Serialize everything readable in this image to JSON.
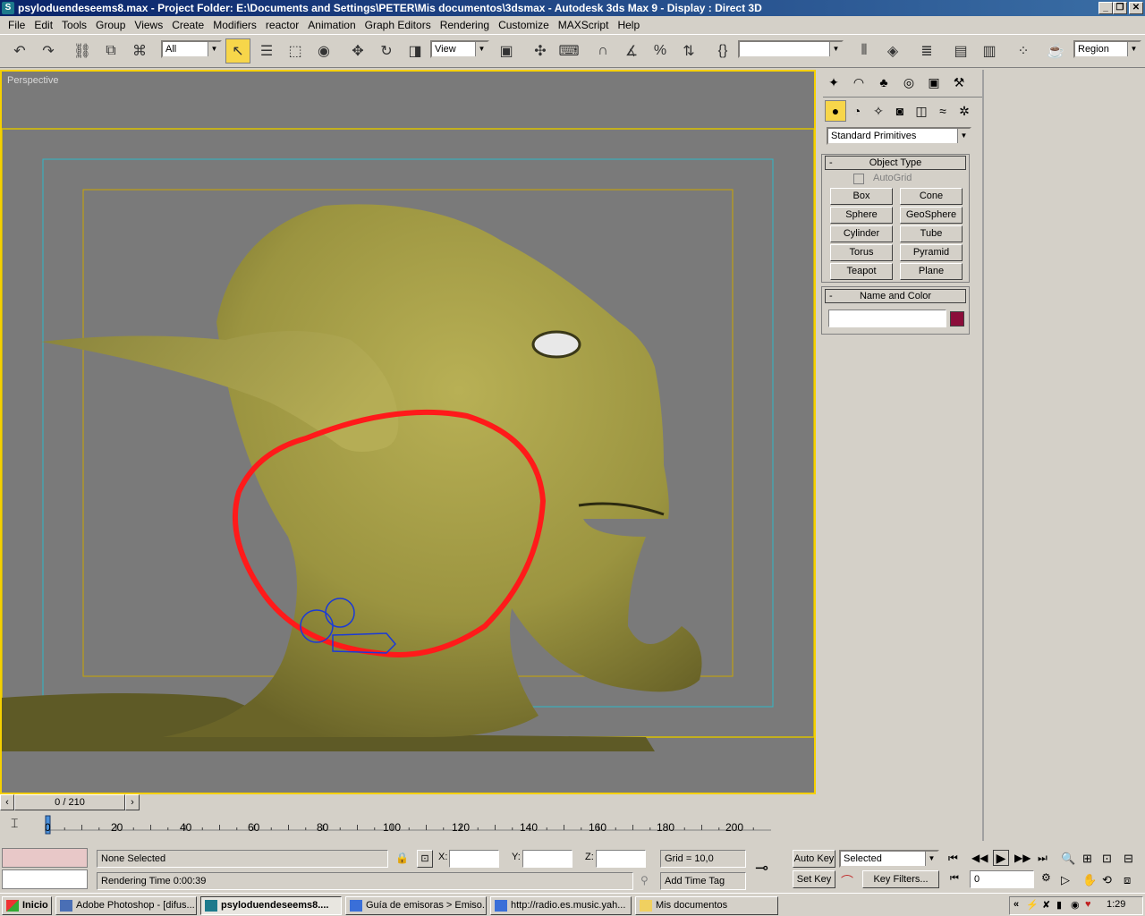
{
  "window": {
    "title": "psyloduendeseems8.max     - Project Folder: E:\\Documents and Settings\\PETER\\Mis documentos\\3dsmax     - Autodesk 3ds Max 9     - Display : Direct 3D",
    "min": "_",
    "max": "❐",
    "close": "✕"
  },
  "menu": [
    "File",
    "Edit",
    "Tools",
    "Group",
    "Views",
    "Create",
    "Modifiers",
    "reactor",
    "Animation",
    "Graph Editors",
    "Rendering",
    "Customize",
    "MAXScript",
    "Help"
  ],
  "toolbar": {
    "selection_filter": "All",
    "ref_coord": "View",
    "named_selection": "",
    "render_type": "Region"
  },
  "viewport": {
    "label": "Perspective"
  },
  "command_panel": {
    "category": "Standard Primitives",
    "object_type_title": "Object Type",
    "autogrid": "AutoGrid",
    "buttons": [
      "Box",
      "Cone",
      "Sphere",
      "GeoSphere",
      "Cylinder",
      "Tube",
      "Torus",
      "Pyramid",
      "Teapot",
      "Plane"
    ],
    "name_color_title": "Name and Color",
    "name_value": "",
    "color": "#8b0d3a"
  },
  "timeline": {
    "frame": "0 / 210",
    "ticks": [
      "0",
      "20",
      "40",
      "60",
      "80",
      "100",
      "120",
      "140",
      "160",
      "180",
      "200"
    ]
  },
  "status": {
    "selection": "None Selected",
    "prompt": "Rendering Time  0:00:39",
    "x_label": "X:",
    "y_label": "Y:",
    "z_label": "Z:",
    "grid": "Grid = 10,0",
    "add_time_tag": "Add Time Tag",
    "auto_key": "Auto Key",
    "set_key": "Set Key",
    "key_mode": "Selected",
    "key_filters": "Key Filters...",
    "current_frame": "0"
  },
  "taskbar": {
    "start": "Inicio",
    "tasks": [
      "Adobe Photoshop - [difus...",
      "psyloduendeseems8....",
      "Guía de emisoras > Emiso...",
      "http://radio.es.music.yah...",
      "Mis documentos"
    ],
    "clock": "1:29",
    "chevron": "«"
  }
}
